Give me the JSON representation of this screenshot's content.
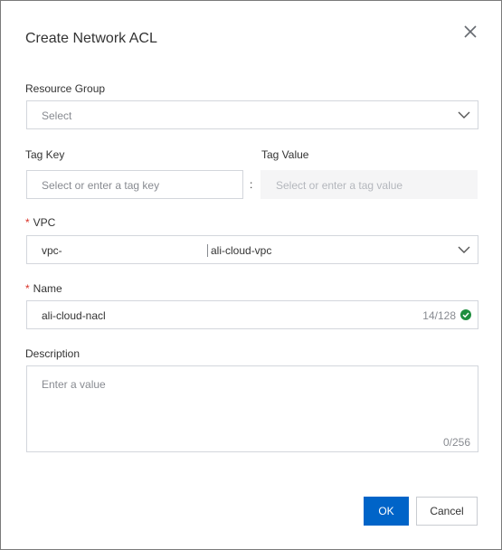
{
  "dialog": {
    "title": "Create Network ACL"
  },
  "form": {
    "resource_group": {
      "label": "Resource Group",
      "placeholder": "Select"
    },
    "tag_key": {
      "label": "Tag Key",
      "placeholder": "Select or enter a tag key"
    },
    "tag_separator": ":",
    "tag_value": {
      "label": "Tag Value",
      "placeholder": "Select or enter a tag value"
    },
    "vpc": {
      "required_mark": "*",
      "label": "VPC",
      "value_id": "vpc-",
      "value_name": "ali-cloud-vpc"
    },
    "name": {
      "required_mark": "*",
      "label": "Name",
      "value": "ali-cloud-nacl",
      "counter": "14/128"
    },
    "description": {
      "label": "Description",
      "placeholder": "Enter a value",
      "counter": "0/256"
    }
  },
  "footer": {
    "ok_label": "OK",
    "cancel_label": "Cancel"
  },
  "colors": {
    "primary": "#0064c8",
    "required": "#d93026",
    "valid": "#1e8e3e",
    "border": "#d3d6dc"
  },
  "icons": {
    "close": "close-icon",
    "dropdown": "chevron-down-icon",
    "valid": "check-circle-icon"
  }
}
